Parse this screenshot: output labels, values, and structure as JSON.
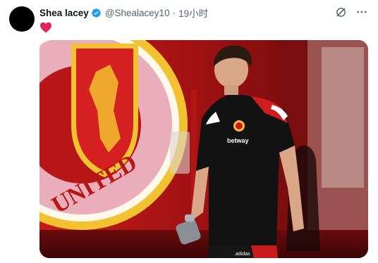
{
  "post": {
    "author_name": "Shea lacey",
    "author_handle": "@Shealacey10",
    "separator": "·",
    "timestamp": "19小时",
    "text_emoji": "heart"
  },
  "icons": {
    "verified": "verified-badge-icon",
    "grok": "grok-icon",
    "more": "more-options-icon",
    "heart": "red-heart-emoji"
  },
  "media": {
    "crest_text": "UNITED",
    "sponsor_text": "betway",
    "brand_text": "adidas"
  },
  "colors": {
    "verified_blue": "#1d9bf0",
    "heart_red": "#e0245e",
    "muted_text": "#536471"
  }
}
